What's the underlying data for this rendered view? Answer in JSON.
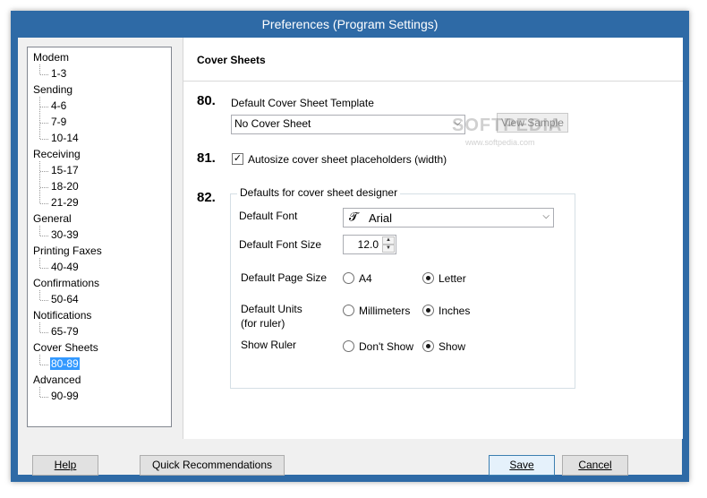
{
  "window": {
    "title": "Preferences (Program Settings)"
  },
  "tree": {
    "groups": [
      {
        "label": "Modem",
        "children": [
          "1-3"
        ]
      },
      {
        "label": "Sending",
        "children": [
          "4-6",
          "7-9",
          "10-14"
        ]
      },
      {
        "label": "Receiving",
        "children": [
          "15-17",
          "18-20",
          "21-29"
        ]
      },
      {
        "label": "General",
        "children": [
          "30-39"
        ]
      },
      {
        "label": "Printing Faxes",
        "children": [
          "40-49"
        ]
      },
      {
        "label": "Confirmations",
        "children": [
          "50-64"
        ]
      },
      {
        "label": "Notifications",
        "children": [
          "65-79"
        ]
      },
      {
        "label": "Cover Sheets",
        "children": [
          "80-89"
        ]
      },
      {
        "label": "Advanced",
        "children": [
          "90-99"
        ]
      }
    ],
    "selected": "80-89"
  },
  "panel": {
    "title": "Cover Sheets",
    "s80": {
      "num": "80.",
      "label": "Default Cover Sheet Template",
      "value": "No Cover Sheet",
      "button": "View Sample"
    },
    "s81": {
      "num": "81.",
      "label": "Autosize cover sheet placeholders (width)",
      "checked": true
    },
    "s82": {
      "num": "82.",
      "group_title": "Defaults for cover sheet designer",
      "font_label": "Default Font",
      "font_value": "Arial",
      "font_icon": "truetype-font-icon",
      "size_label": "Default Font Size",
      "size_value": "12.0",
      "page_label": "Default Page Size",
      "page_options": [
        "A4",
        "Letter"
      ],
      "page_selected": "Letter",
      "units_label_1": "Default Units",
      "units_label_2": "(for ruler)",
      "units_options": [
        "Millimeters",
        "Inches"
      ],
      "units_selected": "Inches",
      "ruler_label": "Show Ruler",
      "ruler_options": [
        "Don't Show",
        "Show"
      ],
      "ruler_selected": "Show"
    }
  },
  "watermark": {
    "text": "SOFTPEDIA",
    "url_text": "www.softpedia.com"
  },
  "buttons": {
    "help": "Help",
    "quick": "Quick Recommendations",
    "save": "Save",
    "cancel": "Cancel"
  }
}
